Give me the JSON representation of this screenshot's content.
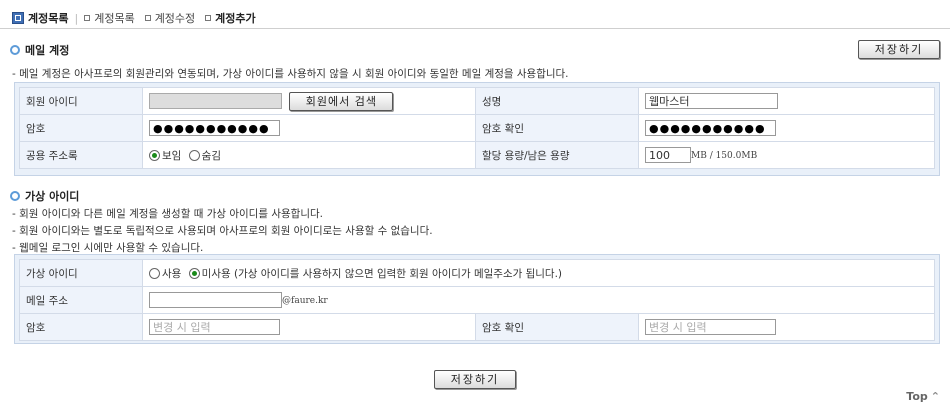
{
  "nav": {
    "title": "계정목록",
    "links": [
      "계정목록",
      "계정수정",
      "계정추가"
    ]
  },
  "mail_section": {
    "title": "메일 계정",
    "save_label": "저장하기",
    "desc": "- 메일 계정은 아사프로의 회원관리와 연동되며, 가상 아이디를 사용하지 않을 시 회원 아이디와 동일한 메일 계정을 사용합니다.",
    "fields": {
      "member_id_label": "회원 아이디",
      "member_id_value": "",
      "search_button": "회원에서 검색",
      "name_label": "성명",
      "name_value": "웹마스터",
      "pw_label": "암호",
      "pw_value": "●●●●●●●●●●●",
      "pw_confirm_label": "암호 확인",
      "pw_confirm_value": "●●●●●●●●●●●",
      "addrbook_label": "공용 주소록",
      "addrbook_show": "보임",
      "addrbook_hide": "숨김",
      "quota_label": "할당 용량/남은 용량",
      "quota_value": "100",
      "quota_unit": "MB / 150.0MB"
    }
  },
  "virtual_section": {
    "title": "가상 아이디",
    "desc": [
      "- 회원 아이디와 다른 메일 계정을 생성할 때 가상 아이디를 사용합니다.",
      "- 회원 아이디와는 별도로 독립적으로 사용되며 아사프로의 회원 아이디로는 사용할 수 없습니다.",
      "- 웹메일 로그인 시에만 사용할 수 있습니다."
    ],
    "fields": {
      "vid_label": "가상 아이디",
      "use_label": "사용",
      "nouse_label": "미사용 (가상 아이디를 사용하지 않으면 입력한 회원 아이디가 메일주소가 됩니다.)",
      "email_label": "메일 주소",
      "email_value": "",
      "email_domain": "@faure.kr",
      "pw_label": "암호",
      "pw_placeholder": "변경 시 입력",
      "pw_confirm_label": "암호 확인",
      "pw_confirm_placeholder": "변경 시 입력"
    }
  },
  "bottom": {
    "save_label": "저장하기",
    "top_label": "Top"
  },
  "colors": {
    "accent": "#5d9bd8",
    "label_bg": "#eef3fb"
  }
}
